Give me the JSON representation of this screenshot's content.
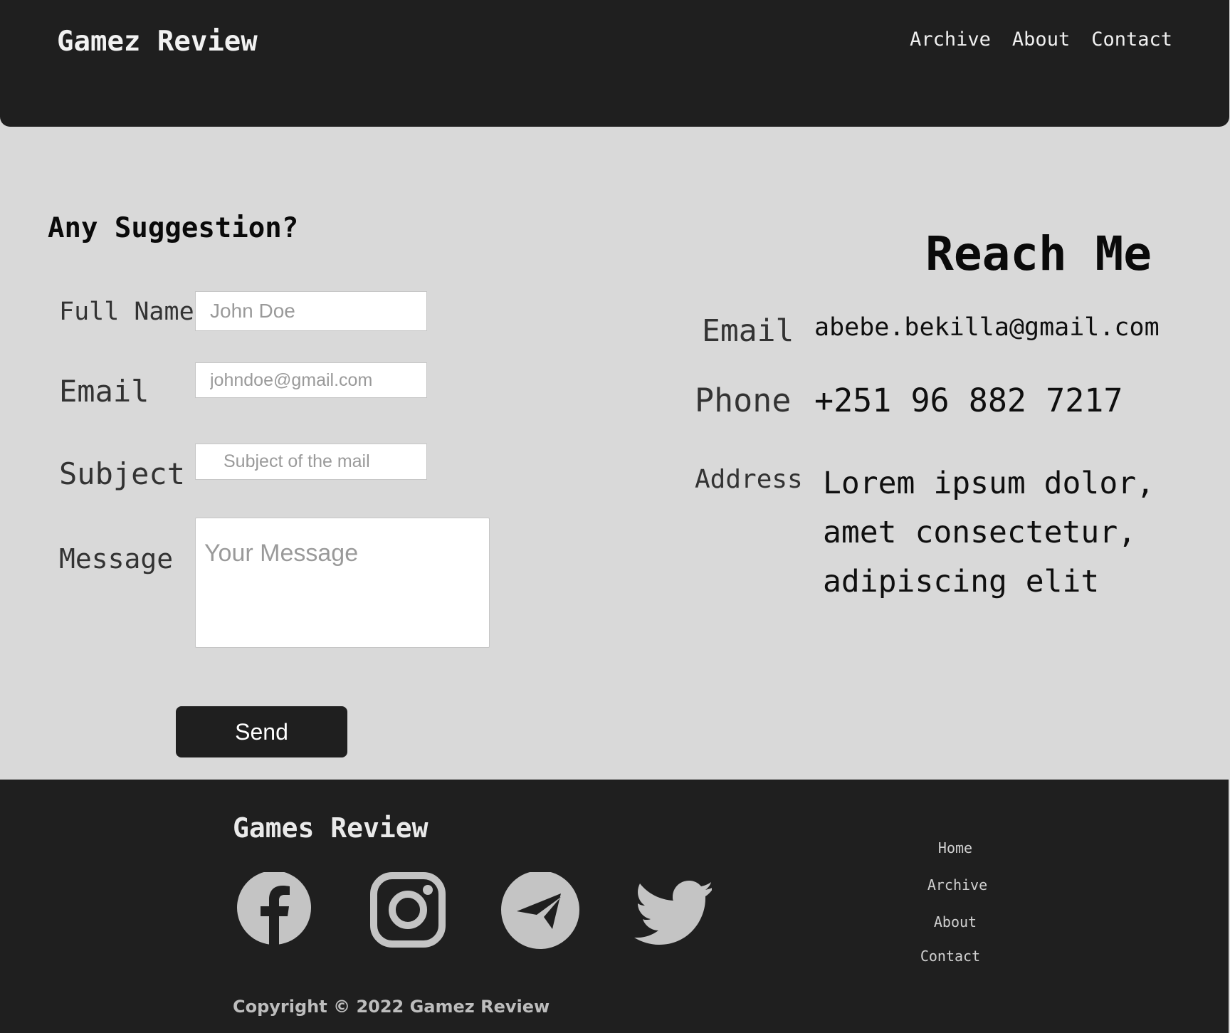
{
  "header": {
    "brand": "Gamez Review",
    "nav": [
      "Archive",
      "About",
      "Contact"
    ]
  },
  "form": {
    "title": "Any Suggestion?",
    "full_name_label": "Full Name",
    "full_name_placeholder": "John Doe",
    "email_label": "Email",
    "email_placeholder": "johndoe@gmail.com",
    "subject_label": "Subject",
    "subject_placeholder": "Subject of the mail",
    "message_label": "Message",
    "message_placeholder": "Your Message",
    "send_label": "Send"
  },
  "contact": {
    "title": "Reach Me",
    "email_label": "Email",
    "email_value": "abebe.bekilla@gmail.com",
    "phone_label": "Phone",
    "phone_value": "+251 96 882 7217",
    "address_label": "Address",
    "address_lines": [
      "Lorem ipsum dolor,",
      "amet consectetur,",
      "adipiscing elit"
    ]
  },
  "footer": {
    "brand": "Games Review",
    "social_icons": [
      "facebook-icon",
      "instagram-icon",
      "telegram-icon",
      "twitter-icon"
    ],
    "links": [
      "Home",
      "Archive",
      "About",
      "Contact"
    ],
    "copyright": "Copyright © 2022 Gamez Review"
  },
  "colors": {
    "dark": "#1f1f1f",
    "background": "#d9d9d9",
    "icon": "#c4c4c4"
  }
}
